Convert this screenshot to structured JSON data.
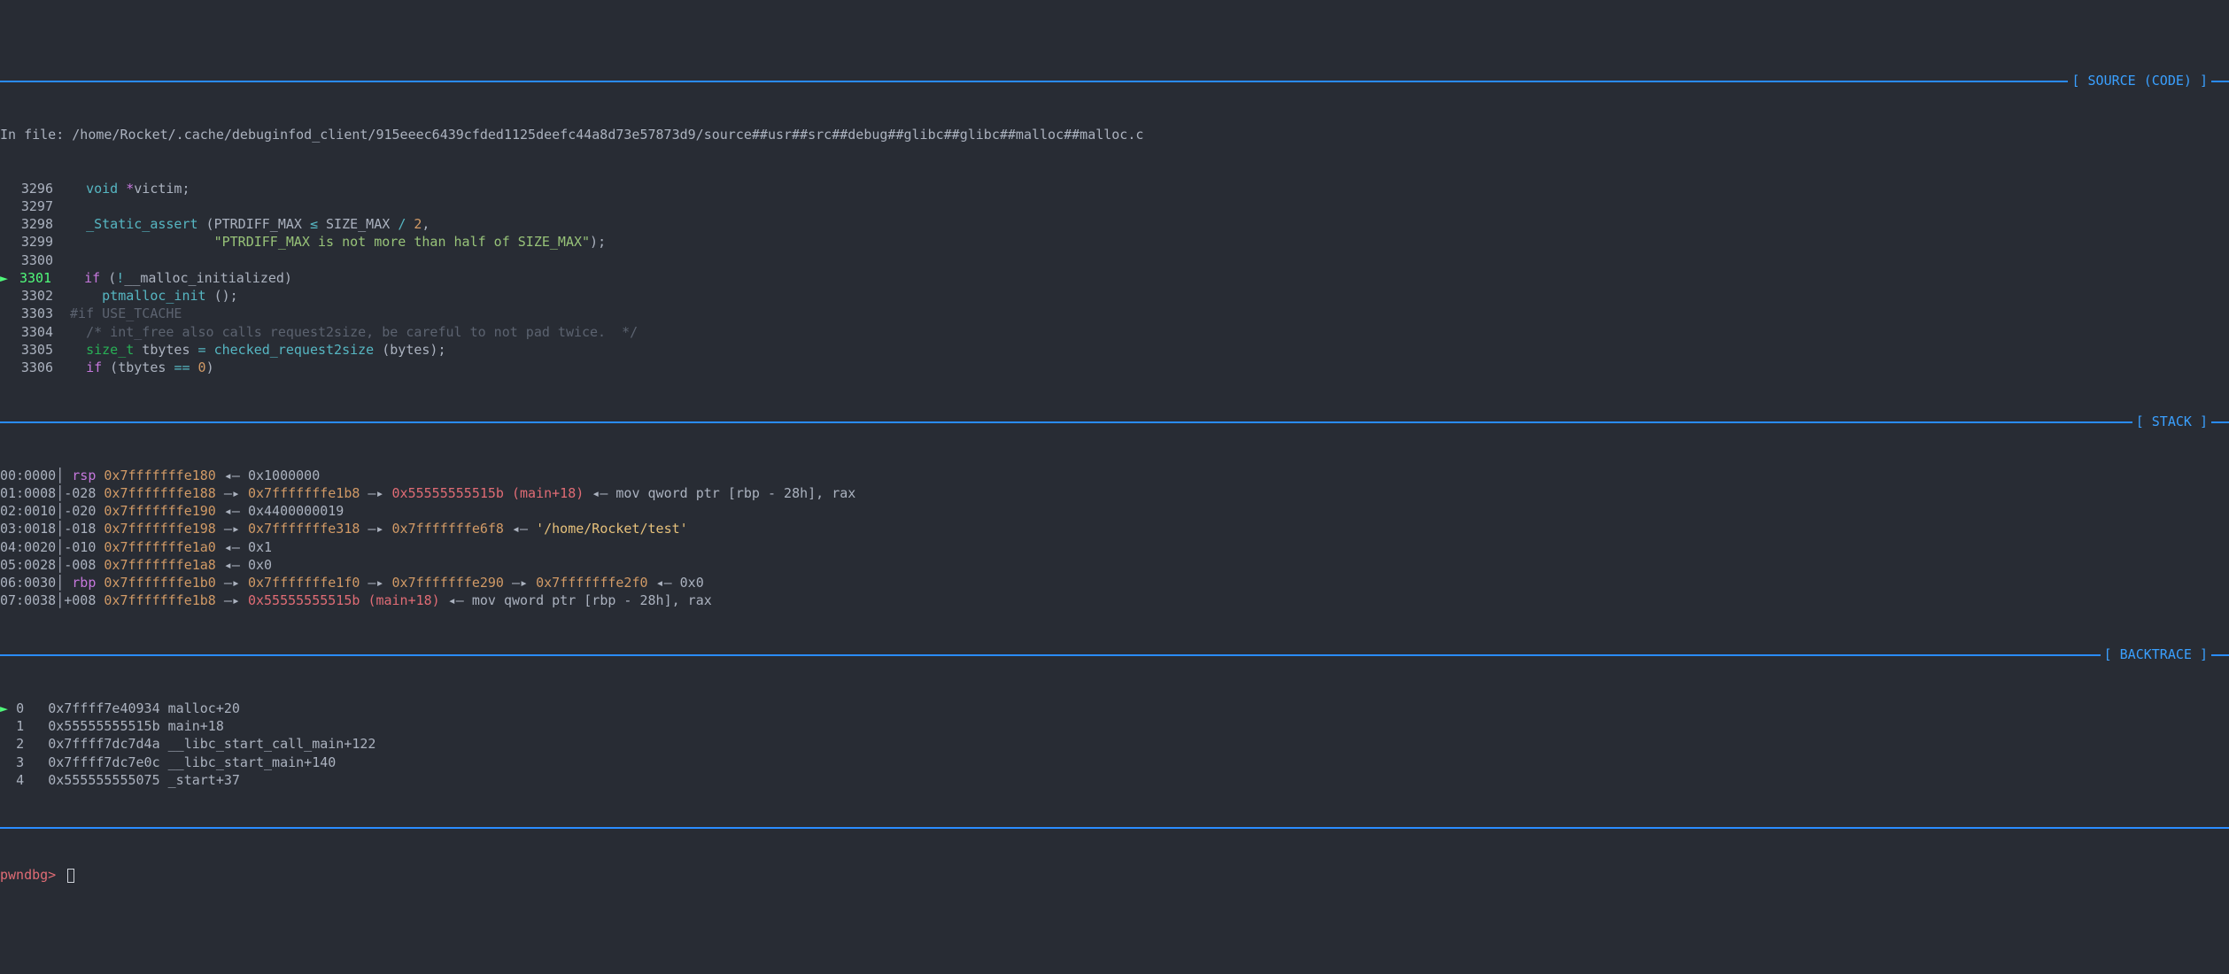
{
  "sections": {
    "source": "[ SOURCE (CODE) ]",
    "stack": "[ STACK ]",
    "backtrace": "[ BACKTRACE ]"
  },
  "source": {
    "file_prefix": "In file: ",
    "file_path": "/home/Rocket/.cache/debuginfod_client/915eeec6439cfded1125deefc44a8d73e57873d9/source##usr##src##debug##glibc##glibc##malloc##malloc.c",
    "lines": [
      {
        "n": "3296",
        "mark": "",
        "tokens": [
          {
            "c": "kw-void",
            "t": "  void "
          },
          {
            "c": "star",
            "t": "*"
          },
          {
            "c": "txt",
            "t": "victim;"
          }
        ]
      },
      {
        "n": "3297",
        "mark": "",
        "tokens": []
      },
      {
        "n": "3298",
        "mark": "",
        "tokens": [
          {
            "c": "txt",
            "t": "  "
          },
          {
            "c": "fn-name",
            "t": "_Static_assert"
          },
          {
            "c": "txt",
            "t": " (PTRDIFF_MAX "
          },
          {
            "c": "op",
            "t": "≤"
          },
          {
            "c": "txt",
            "t": " SIZE_MAX "
          },
          {
            "c": "op",
            "t": "/"
          },
          {
            "c": "txt",
            "t": " "
          },
          {
            "c": "num",
            "t": "2"
          },
          {
            "c": "txt",
            "t": ","
          }
        ]
      },
      {
        "n": "3299",
        "mark": "",
        "tokens": [
          {
            "c": "txt",
            "t": "                  "
          },
          {
            "c": "str",
            "t": "\"PTRDIFF_MAX is not more than half of SIZE_MAX\""
          },
          {
            "c": "txt",
            "t": ");"
          }
        ]
      },
      {
        "n": "3300",
        "mark": "",
        "tokens": []
      },
      {
        "n": "3301",
        "mark": "► ",
        "tokens": [
          {
            "c": "txt",
            "t": "  "
          },
          {
            "c": "kw-if",
            "t": "if"
          },
          {
            "c": "txt",
            "t": " ("
          },
          {
            "c": "op",
            "t": "!"
          },
          {
            "c": "txt",
            "t": "__malloc_initialized)"
          }
        ]
      },
      {
        "n": "3302",
        "mark": "",
        "tokens": [
          {
            "c": "txt",
            "t": "    "
          },
          {
            "c": "fn-name",
            "t": "ptmalloc_init"
          },
          {
            "c": "txt",
            "t": " ();"
          }
        ]
      },
      {
        "n": "3303",
        "mark": "",
        "tokens": [
          {
            "c": "comment",
            "t": "#if USE_TCACHE"
          }
        ]
      },
      {
        "n": "3304",
        "mark": "",
        "tokens": [
          {
            "c": "comment",
            "t": "  /* int_free also calls request2size, be careful to not pad twice.  */"
          }
        ]
      },
      {
        "n": "3305",
        "mark": "",
        "tokens": [
          {
            "c": "txt",
            "t": "  "
          },
          {
            "c": "kw-size",
            "t": "size_t"
          },
          {
            "c": "txt",
            "t": " tbytes "
          },
          {
            "c": "op",
            "t": "="
          },
          {
            "c": "txt",
            "t": " "
          },
          {
            "c": "fn-name",
            "t": "checked_request2size"
          },
          {
            "c": "txt",
            "t": " (bytes);"
          }
        ]
      },
      {
        "n": "3306",
        "mark": "",
        "tokens": [
          {
            "c": "txt",
            "t": "  "
          },
          {
            "c": "kw-if",
            "t": "if"
          },
          {
            "c": "txt",
            "t": " (tbytes "
          },
          {
            "c": "op",
            "t": "=="
          },
          {
            "c": "txt",
            "t": " "
          },
          {
            "c": "num",
            "t": "0"
          },
          {
            "c": "txt",
            "t": ")"
          }
        ]
      }
    ]
  },
  "stack": [
    {
      "idx": "00:0000",
      "reg": "rsp ",
      "off": "",
      "chain": [
        {
          "c": "addr-cyan",
          "t": "0x7fffffffe180"
        },
        {
          "c": "arrow",
          "t": " ◂— "
        },
        {
          "c": "txt",
          "t": "0x1000000"
        }
      ]
    },
    {
      "idx": "01:0008",
      "reg": "",
      "off": "-028 ",
      "chain": [
        {
          "c": "addr-cyan",
          "t": "0x7fffffffe188"
        },
        {
          "c": "arrow",
          "t": " —▸ "
        },
        {
          "c": "addr-cyan",
          "t": "0x7fffffffe1b8"
        },
        {
          "c": "arrow",
          "t": " —▸ "
        },
        {
          "c": "addr-red",
          "t": "0x55555555515b"
        },
        {
          "c": "txt",
          "t": " "
        },
        {
          "c": "sym",
          "t": "(main+18)"
        },
        {
          "c": "arrow",
          "t": " ◂— "
        },
        {
          "c": "asm",
          "t": "mov qword ptr [rbp - 28h], rax"
        }
      ]
    },
    {
      "idx": "02:0010",
      "reg": "",
      "off": "-020 ",
      "chain": [
        {
          "c": "addr-cyan",
          "t": "0x7fffffffe190"
        },
        {
          "c": "arrow",
          "t": " ◂— "
        },
        {
          "c": "txt",
          "t": "0x4400000019"
        }
      ]
    },
    {
      "idx": "03:0018",
      "reg": "",
      "off": "-018 ",
      "chain": [
        {
          "c": "addr-cyan",
          "t": "0x7fffffffe198"
        },
        {
          "c": "arrow",
          "t": " —▸ "
        },
        {
          "c": "addr-cyan",
          "t": "0x7fffffffe318"
        },
        {
          "c": "arrow",
          "t": " —▸ "
        },
        {
          "c": "addr-cyan",
          "t": "0x7fffffffe6f8"
        },
        {
          "c": "arrow",
          "t": " ◂— "
        },
        {
          "c": "yel",
          "t": "'/home/Rocket/test'"
        }
      ]
    },
    {
      "idx": "04:0020",
      "reg": "",
      "off": "-010 ",
      "chain": [
        {
          "c": "addr-cyan",
          "t": "0x7fffffffe1a0"
        },
        {
          "c": "arrow",
          "t": " ◂— "
        },
        {
          "c": "txt",
          "t": "0x1"
        }
      ]
    },
    {
      "idx": "05:0028",
      "reg": "",
      "off": "-008 ",
      "chain": [
        {
          "c": "addr-cyan",
          "t": "0x7fffffffe1a8"
        },
        {
          "c": "arrow",
          "t": " ◂— "
        },
        {
          "c": "txt",
          "t": "0x0"
        }
      ]
    },
    {
      "idx": "06:0030",
      "reg": "rbp ",
      "off": "",
      "chain": [
        {
          "c": "addr-cyan",
          "t": "0x7fffffffe1b0"
        },
        {
          "c": "arrow",
          "t": " —▸ "
        },
        {
          "c": "addr-cyan",
          "t": "0x7fffffffe1f0"
        },
        {
          "c": "arrow",
          "t": " —▸ "
        },
        {
          "c": "addr-cyan",
          "t": "0x7fffffffe290"
        },
        {
          "c": "arrow",
          "t": " —▸ "
        },
        {
          "c": "addr-cyan",
          "t": "0x7fffffffe2f0"
        },
        {
          "c": "arrow",
          "t": " ◂— "
        },
        {
          "c": "txt",
          "t": "0x0"
        }
      ]
    },
    {
      "idx": "07:0038",
      "reg": "",
      "off": "+008 ",
      "chain": [
        {
          "c": "addr-cyan",
          "t": "0x7fffffffe1b8"
        },
        {
          "c": "arrow",
          "t": " —▸ "
        },
        {
          "c": "addr-red",
          "t": "0x55555555515b"
        },
        {
          "c": "txt",
          "t": " "
        },
        {
          "c": "sym",
          "t": "(main+18)"
        },
        {
          "c": "arrow",
          "t": " ◂— "
        },
        {
          "c": "asm",
          "t": "mov qword ptr [rbp - 28h], rax"
        }
      ]
    }
  ],
  "backtrace": [
    {
      "mark": "► ",
      "i": "0",
      "addr": "0x7ffff7e40934",
      "sym": "malloc+20"
    },
    {
      "mark": "  ",
      "i": "1",
      "addr": "0x55555555515b",
      "sym": "main+18"
    },
    {
      "mark": "  ",
      "i": "2",
      "addr": "0x7ffff7dc7d4a",
      "sym": "__libc_start_call_main+122"
    },
    {
      "mark": "  ",
      "i": "3",
      "addr": "0x7ffff7dc7e0c",
      "sym": "__libc_start_main+140"
    },
    {
      "mark": "  ",
      "i": "4",
      "addr": "0x555555555075",
      "sym": "_start+37"
    }
  ],
  "prompt": "pwndbg> "
}
